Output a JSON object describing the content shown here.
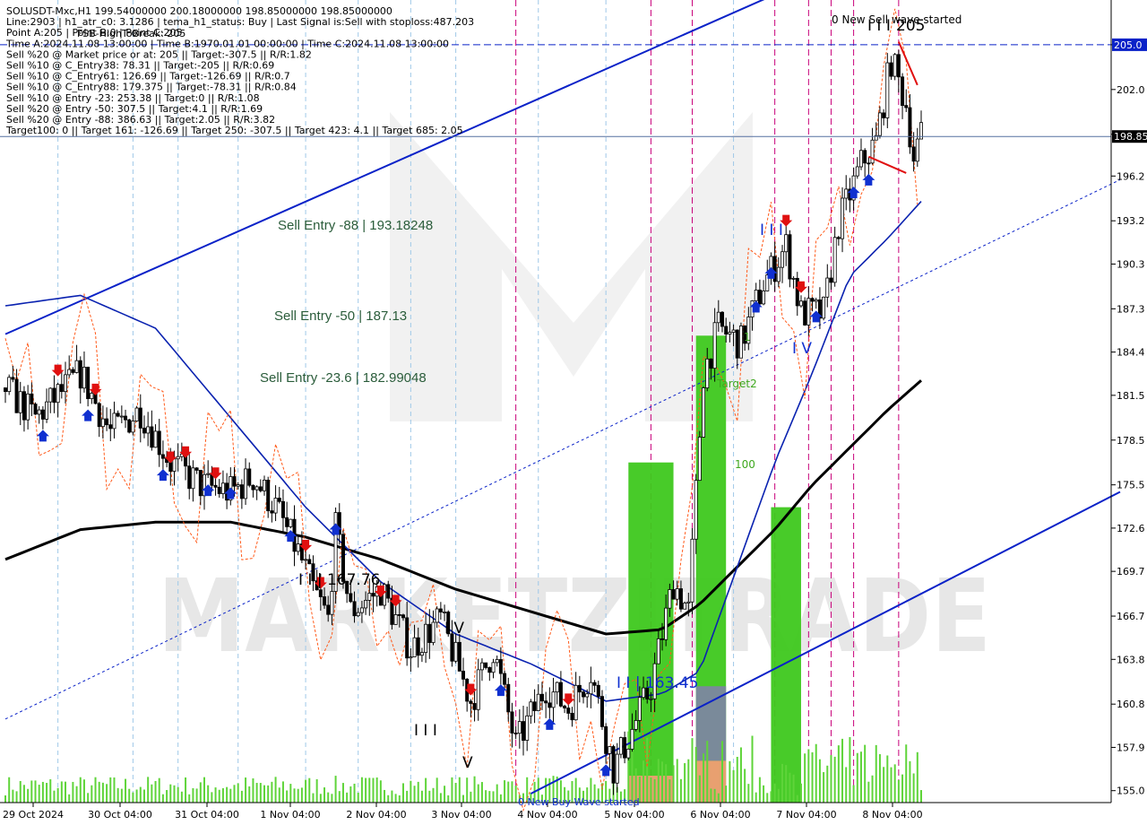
{
  "header": {
    "lines": [
      "SOLUSDT-Mxc,H1  199.54000000 200.18000000 198.85000000 198.85000000",
      "Line:2903  |  h1_atr_c0: 3.1286  |  tema_h1_status: Buy  |  Last Signal is:Sell with stoploss:487.203",
      "Point A:205  |  Point B:0  |  Point C:205",
      "Time A:2024.11.08 13:00:00  |  Time B:1970.01.01 00:00:00  |  Time C:2024.11.08 13:00:00",
      "Sell %20 @ Market price or at: 205  ||  Target:-307.5  ||  R/R:1.82",
      "Sell %10 @ C_Entry38: 78.31  ||  Target:-205  ||  R/R:0.69",
      "Sell %10 @ C_Entry61: 126.69  ||  Target:-126.69  ||  R/R:0.7",
      "Sell %10 @ C_Entry88: 179.375  ||  Target:-78.31  ||  R/R:0.84",
      "Sell %10 @ Entry -23: 253.38  ||  Target:0  ||  R/R:1.08",
      "Sell %20 @ Entry -50: 307.5  ||  Target:4.1  ||  R/R:1.69",
      "Sell %20 @ Entry -88: 386.63  ||  Target:2.05  ||  R/R:3.82",
      "Target100: 0  ||  Target 161: -126.69  ||  Target 250: -307.5  ||  Target 423: 4.1  ||  Target 685: 2.05"
    ],
    "overlap_text": "FSB-HighToBreak: 205"
  },
  "watermark_text": "MARKETZITRADE",
  "annotations": {
    "sell_entry_88": "Sell Entry -88 | 193.18248",
    "sell_entry_50": "Sell Entry -50 | 187.13",
    "sell_entry_23": "Sell Entry -23.6 | 182.99048",
    "level_16776": "I I | 167.76",
    "level_16345": "I I | 163.45",
    "wave_iii_a": "I I I",
    "wave_iv_a": "I V",
    "wave_v_a": "V",
    "wave_iii_b": "I I I",
    "wave_iv_b": "I V",
    "wave_top": "I I I",
    "wave_top_value": "205",
    "new_sell_wave": "0 New Sell wave started",
    "new_buy_wave": "0 New Buy Wave started",
    "target2": "Target2",
    "t100": "100",
    "t1": "1"
  },
  "price_tags": {
    "top_level": "205.0",
    "current": "198.85"
  },
  "colors": {
    "up_candle": "#000000",
    "channel": "#0a22c8",
    "ma_blue": "#0a22b0",
    "ma_black": "#000000",
    "stop_line": "#ff5a1a",
    "vline": "#c8007a",
    "vline_light": "#9fc8e8",
    "green_bar": "#3ec81e",
    "volume": "#5fd43a",
    "sell_arrow": "#e01010",
    "buy_arrow": "#1030d0"
  },
  "chart_data": {
    "type": "candlestick",
    "symbol": "SOLUSDT-Mxc",
    "timeframe": "H1",
    "y_axis": {
      "ticks": [
        "205.0",
        "202.0",
        "199.0",
        "196.2",
        "193.2",
        "190.3",
        "187.3",
        "184.4",
        "181.5",
        "178.5",
        "175.5",
        "172.6",
        "169.7",
        "166.7",
        "163.8",
        "160.8",
        "157.9",
        "155.0"
      ],
      "ylim": [
        154.2,
        208.0
      ]
    },
    "x_axis": {
      "ticks": [
        "29 Oct 2024",
        "30 Oct 04:00",
        "31 Oct 04:00",
        "1 Nov 04:00",
        "2 Nov 04:00",
        "3 Nov 04:00",
        "4 Nov 04:00",
        "5 Nov 04:00",
        "6 Nov 04:00",
        "7 Nov 04:00",
        "8 Nov 04:00"
      ],
      "num_bars": 245
    },
    "price_path": [
      [
        0,
        182.0
      ],
      [
        8,
        180.0
      ],
      [
        14,
        181.5
      ],
      [
        20,
        183.0
      ],
      [
        28,
        179.0
      ],
      [
        36,
        180.5
      ],
      [
        44,
        177.0
      ],
      [
        52,
        175.5
      ],
      [
        60,
        175.0
      ],
      [
        66,
        176.0
      ],
      [
        72,
        174.0
      ],
      [
        78,
        171.0
      ],
      [
        82,
        168.5
      ],
      [
        86,
        166.5
      ],
      [
        88,
        172.5
      ],
      [
        92,
        167.0
      ],
      [
        100,
        168.5
      ],
      [
        108,
        164.5
      ],
      [
        116,
        166.5
      ],
      [
        124,
        161.0
      ],
      [
        130,
        164.5
      ],
      [
        136,
        158.0
      ],
      [
        144,
        162.0
      ],
      [
        150,
        160.5
      ],
      [
        156,
        163.0
      ],
      [
        162,
        156.5
      ],
      [
        166,
        158.5
      ],
      [
        172,
        162.0
      ],
      [
        178,
        169.0
      ],
      [
        182,
        167.0
      ],
      [
        186,
        183.0
      ],
      [
        190,
        186.0
      ],
      [
        196,
        185.0
      ],
      [
        202,
        189.0
      ],
      [
        208,
        191.5
      ],
      [
        212,
        187.0
      ],
      [
        218,
        187.0
      ],
      [
        222,
        193.0
      ],
      [
        228,
        197.0
      ],
      [
        232,
        198.5
      ],
      [
        236,
        204.0
      ],
      [
        240,
        201.0
      ],
      [
        242,
        197.5
      ],
      [
        244,
        198.85
      ]
    ],
    "ma_blue": [
      [
        0,
        187.5
      ],
      [
        20,
        188.2
      ],
      [
        40,
        186.0
      ],
      [
        60,
        180.0
      ],
      [
        80,
        174.0
      ],
      [
        100,
        169.0
      ],
      [
        120,
        165.5
      ],
      [
        140,
        163.5
      ],
      [
        160,
        161.0
      ],
      [
        175,
        161.5
      ],
      [
        185,
        163.0
      ],
      [
        195,
        170.0
      ],
      [
        205,
        177.0
      ],
      [
        215,
        183.0
      ],
      [
        225,
        189.5
      ],
      [
        235,
        192.0
      ],
      [
        244,
        194.5
      ]
    ],
    "ma_black": [
      [
        0,
        170.5
      ],
      [
        20,
        172.5
      ],
      [
        40,
        173.0
      ],
      [
        60,
        173.0
      ],
      [
        80,
        172.0
      ],
      [
        100,
        170.5
      ],
      [
        120,
        168.5
      ],
      [
        140,
        167.0
      ],
      [
        160,
        165.5
      ],
      [
        175,
        165.8
      ],
      [
        185,
        167.5
      ],
      [
        195,
        170.0
      ],
      [
        205,
        172.5
      ],
      [
        215,
        175.5
      ],
      [
        225,
        178.0
      ],
      [
        235,
        180.5
      ],
      [
        244,
        182.5
      ]
    ],
    "channel_upper": [
      [
        0,
        185.6
      ],
      [
        244,
        212.7
      ]
    ],
    "channel_lower": [
      [
        140,
        154.8
      ],
      [
        244,
        168.2
      ]
    ],
    "channel_mid_dotted": [
      [
        0,
        159.8
      ],
      [
        244,
        189.5
      ]
    ],
    "hlines": [
      205.0,
      198.85
    ],
    "v_lines_bar": [
      136,
      172,
      183,
      205,
      214,
      220,
      226,
      238
    ],
    "v_lines_light_bar": [
      14,
      34,
      46,
      62,
      80,
      94,
      108,
      120,
      142,
      160,
      194
    ],
    "green_bars": [
      {
        "x0": 166,
        "x1": 178,
        "top": 177.0
      },
      {
        "x0": 184,
        "x1": 192,
        "top": 185.5
      },
      {
        "x0": 204,
        "x1": 212,
        "top": 174.0
      }
    ]
  }
}
